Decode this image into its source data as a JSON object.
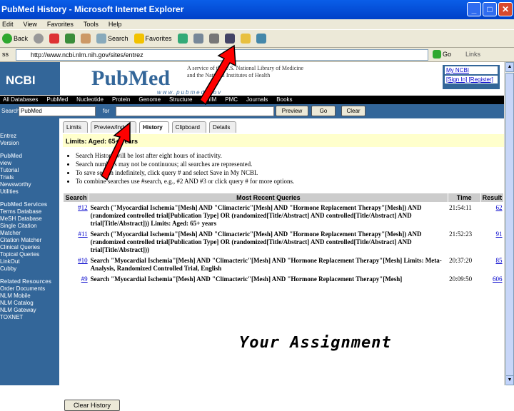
{
  "window": {
    "title": "PubMed History - Microsoft Internet Explorer",
    "min": "_",
    "max": "□",
    "close": "✕"
  },
  "menu": [
    "Edit",
    "View",
    "Favorites",
    "Tools",
    "Help"
  ],
  "toolbar": {
    "back": "Back",
    "search": "Search",
    "favorites": "Favorites"
  },
  "address": {
    "label": "ss",
    "url": "http://www.ncbi.nlm.nih.gov/sites/entrez",
    "go": "Go",
    "links": "Links"
  },
  "header": {
    "ncbi": "NCBI",
    "pubmed": "PubMed",
    "pubmed_sub": "www.pubmed.gov",
    "nlm_line1": "A service of the U.S. National Library of Medicine",
    "nlm_line2": "and the National Institutes of Health",
    "my_ncbi": "My NCBI",
    "sign_in": "[Sign In] [Register]"
  },
  "tabs": [
    "All Databases",
    "PubMed",
    "Nucleotide",
    "Protein",
    "Genome",
    "Structure",
    "OMIM",
    "PMC",
    "Journals",
    "Books"
  ],
  "search": {
    "label": "Search",
    "database": "PubMed",
    "for_label": "for",
    "query": "",
    "preview": "Preview",
    "go": "Go",
    "clear": "Clear"
  },
  "leftnav": [
    {
      "text": "Entrez",
      "hd": false
    },
    {
      "text": "Version",
      "hd": false
    },
    {
      "text": "PubMed",
      "hd": true
    },
    {
      "text": "view",
      "hd": false
    },
    {
      "text": "Tutorial",
      "hd": false
    },
    {
      "text": "Trials",
      "hd": false
    },
    {
      "text": "Newsworthy",
      "hd": false
    },
    {
      "text": "Utilities",
      "hd": false
    },
    {
      "text": "PubMed Services",
      "hd": true
    },
    {
      "text": "Terms Database",
      "hd": false
    },
    {
      "text": "MeSH Database",
      "hd": false
    },
    {
      "text": "Single Citation",
      "hd": false
    },
    {
      "text": "Matcher",
      "hd": false
    },
    {
      "text": "Citation Matcher",
      "hd": false
    },
    {
      "text": "Clinical Queries",
      "hd": false
    },
    {
      "text": "Topical Queries",
      "hd": false
    },
    {
      "text": "LinkOut",
      "hd": false
    },
    {
      "text": "Cubby",
      "hd": false
    },
    {
      "text": "Related Resources",
      "hd": true
    },
    {
      "text": "Order Documents",
      "hd": false
    },
    {
      "text": "NLM Mobile",
      "hd": false
    },
    {
      "text": "NLM Catalog",
      "hd": false
    },
    {
      "text": "NLM Gateway",
      "hd": false
    },
    {
      "text": "TOXNET",
      "hd": false
    }
  ],
  "subtabs": [
    "Limits",
    "Preview/Index",
    "History",
    "Clipboard",
    "Details"
  ],
  "limits": "Limits: Aged: 65+ years",
  "bullets": [
    "Search History will be lost after eight hours of inactivity.",
    "Search numbers may not be continuous; all searches are represented.",
    "To save search indefinitely, click query # and select Save in My NCBI.",
    "To combine searches use #search, e.g., #2 AND #3 or click query # for more options."
  ],
  "table": {
    "headers": [
      "Search",
      "Most Recent Queries",
      "Time",
      "Result"
    ],
    "rows": [
      {
        "num": "#12",
        "query": "Search (\"Myocardial Ischemia\"[Mesh] AND \"Climacteric\"[Mesh] AND \"Hormone Replacement Therapy\"[Mesh]) AND (randomized controlled trial[Publication Type] OR (randomized[Title/Abstract] AND controlled[Title/Abstract] AND trial[Title/Abstract])) Limits: Aged: 65+ years",
        "time": "21:54:11",
        "result": "62"
      },
      {
        "num": "#11",
        "query": "Search (\"Myocardial Ischemia\"[Mesh] AND \"Climacteric\"[Mesh] AND \"Hormone Replacement Therapy\"[Mesh]) AND (randomized controlled trial[Publication Type] OR (randomized[Title/Abstract] AND controlled[Title/Abstract] AND trial[Title/Abstract]))",
        "time": "21:52:23",
        "result": "91"
      },
      {
        "num": "#10",
        "query": "Search \"Myocardial Ischemia\"[Mesh] AND \"Climacteric\"[Mesh] AND \"Hormone Replacement Therapy\"[Mesh] Limits: Meta-Analysis, Randomized Controlled Trial, English",
        "time": "20:37:20",
        "result": "85"
      },
      {
        "num": "#9",
        "query": "Search \"Myocardial Ischemia\"[Mesh] AND \"Climacteric\"[Mesh] AND \"Hormone Replacement Therapy\"[Mesh]",
        "time": "20:09:50",
        "result": "606"
      }
    ]
  },
  "clear_history": "Clear History",
  "assignment": "Your Assignment",
  "colors": {
    "ncbi_blue": "#336699",
    "arrow_red": "#ff0000",
    "ie_blue": "#0a5ee8"
  },
  "icons": [
    "back-icon",
    "forward-icon",
    "stop-icon",
    "refresh-icon",
    "home-icon",
    "search-icon",
    "star-icon",
    "history-icon",
    "mail-icon",
    "print-icon",
    "edit-icon",
    "folder-icon",
    "rss-icon"
  ]
}
